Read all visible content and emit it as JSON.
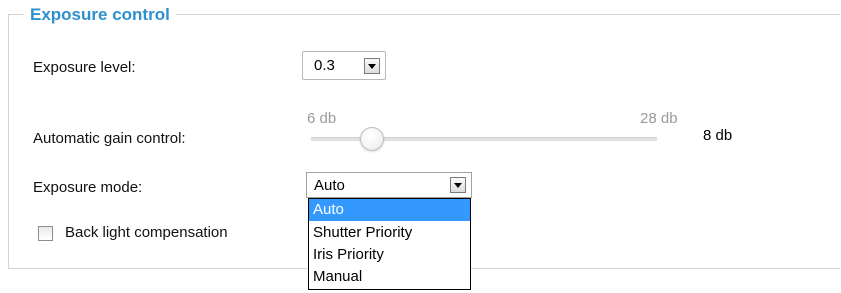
{
  "fieldset": {
    "legend": "Exposure control"
  },
  "exposure_level": {
    "label": "Exposure level:",
    "value": "0.3"
  },
  "gain_control": {
    "label": "Automatic gain control:",
    "min_label": "6 db",
    "max_label": "28 db",
    "min": 6,
    "max": 28,
    "value": 8,
    "value_label": "8 db"
  },
  "exposure_mode": {
    "label": "Exposure mode:",
    "value": "Auto",
    "options": [
      "Auto",
      "Shutter Priority",
      "Iris Priority",
      "Manual"
    ],
    "highlighted_index": 0
  },
  "backlight": {
    "label": "Back light compensation",
    "checked": false
  },
  "colors": {
    "legend": "#2e8fcf",
    "selection": "#3399ff"
  }
}
